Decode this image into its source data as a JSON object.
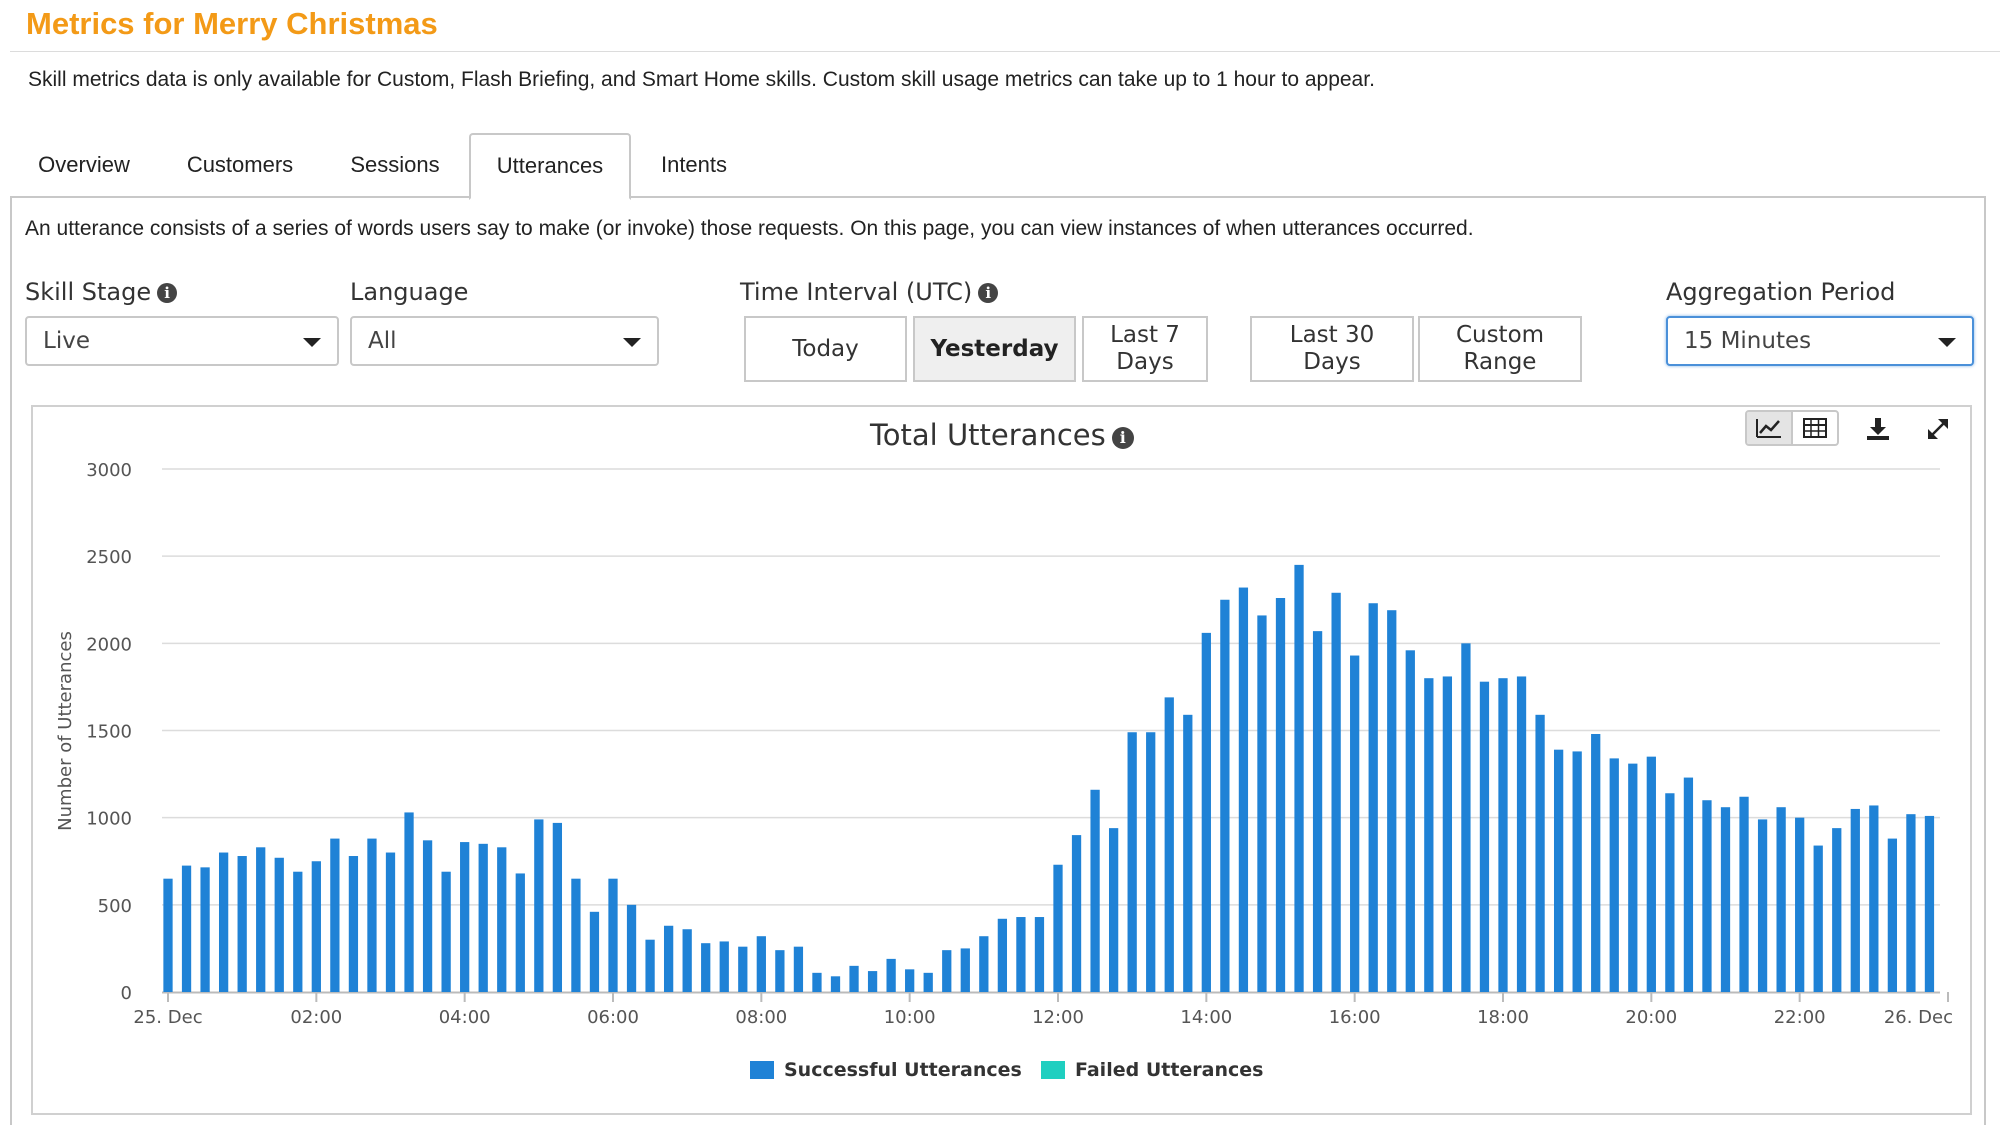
{
  "header": {
    "title": "Metrics for Merry Christmas",
    "notice": "Skill metrics data is only available for Custom, Flash Briefing, and Smart Home skills. Custom skill usage metrics can take up to 1 hour to appear."
  },
  "tabs": [
    {
      "label": "Overview",
      "active": false
    },
    {
      "label": "Customers",
      "active": false
    },
    {
      "label": "Sessions",
      "active": false
    },
    {
      "label": "Utterances",
      "active": true
    },
    {
      "label": "Intents",
      "active": false
    }
  ],
  "description": "An utterance consists of a series of words users say to make (or invoke) those requests. On this page, you can view instances of when utterances occurred.",
  "filters": {
    "skill_stage": {
      "label": "Skill Stage",
      "value": "Live"
    },
    "language": {
      "label": "Language",
      "value": "All"
    },
    "time_interval": {
      "label": "Time Interval (UTC)",
      "buttons": [
        {
          "line1": "Today",
          "line2": "",
          "active": false
        },
        {
          "line1": "Yesterday",
          "line2": "",
          "active": true
        },
        {
          "line1": "Last 7 Days",
          "line2": "",
          "active": false
        },
        {
          "line1": "Last 30",
          "line2": "Days",
          "active": false
        },
        {
          "line1": "Custom",
          "line2": "Range",
          "active": false
        }
      ]
    },
    "aggregation": {
      "label": "Aggregation Period",
      "value": "15 Minutes"
    }
  },
  "icons": {
    "info": "info-icon",
    "line_chart": "line-chart-icon",
    "table": "table-icon",
    "download": "download-icon",
    "expand": "expand-icon",
    "dropdown": "chevron-down-icon"
  },
  "colors": {
    "title": "#f39a17",
    "successful": "#1f82d6",
    "failed": "#1fcfc0",
    "grid": "#dcdcdc"
  },
  "chart_data": {
    "type": "bar",
    "title": "Total Utterances",
    "ylabel": "Number of Utterances",
    "ylim": [
      0,
      3000
    ],
    "yticks": [
      0,
      500,
      1000,
      1500,
      2000,
      2500,
      3000
    ],
    "x_start": "25. Dec 00:00",
    "x_interval": "15 Minutes",
    "x_tick_labels": [
      "25. Dec",
      "02:00",
      "04:00",
      "06:00",
      "08:00",
      "10:00",
      "12:00",
      "14:00",
      "16:00",
      "18:00",
      "20:00",
      "22:00",
      "26. Dec"
    ],
    "grid": true,
    "legend_position": "bottom",
    "series": [
      {
        "name": "Successful Utterances",
        "values": [
          650,
          725,
          715,
          800,
          780,
          830,
          770,
          690,
          750,
          880,
          780,
          880,
          800,
          1030,
          870,
          690,
          860,
          850,
          830,
          680,
          990,
          970,
          650,
          460,
          650,
          500,
          300,
          380,
          360,
          280,
          290,
          260,
          320,
          240,
          260,
          110,
          90,
          150,
          120,
          190,
          130,
          110,
          240,
          250,
          320,
          420,
          430,
          430,
          730,
          900,
          1160,
          940,
          1490,
          1490,
          1690,
          1590,
          2060,
          2250,
          2320,
          2160,
          2260,
          2450,
          2070,
          2290,
          1930,
          2230,
          2190,
          1960,
          1800,
          1810,
          2000,
          1780,
          1800,
          1810,
          1590,
          1390,
          1380,
          1480,
          1340,
          1310,
          1350,
          1140,
          1230,
          1100,
          1060,
          1120,
          990,
          1060,
          1000,
          840,
          940,
          1050,
          1070,
          880,
          1020,
          1010
        ],
        "color": "#1f82d6"
      },
      {
        "name": "Failed Utterances",
        "values": [],
        "color": "#1fcfc0"
      }
    ]
  }
}
